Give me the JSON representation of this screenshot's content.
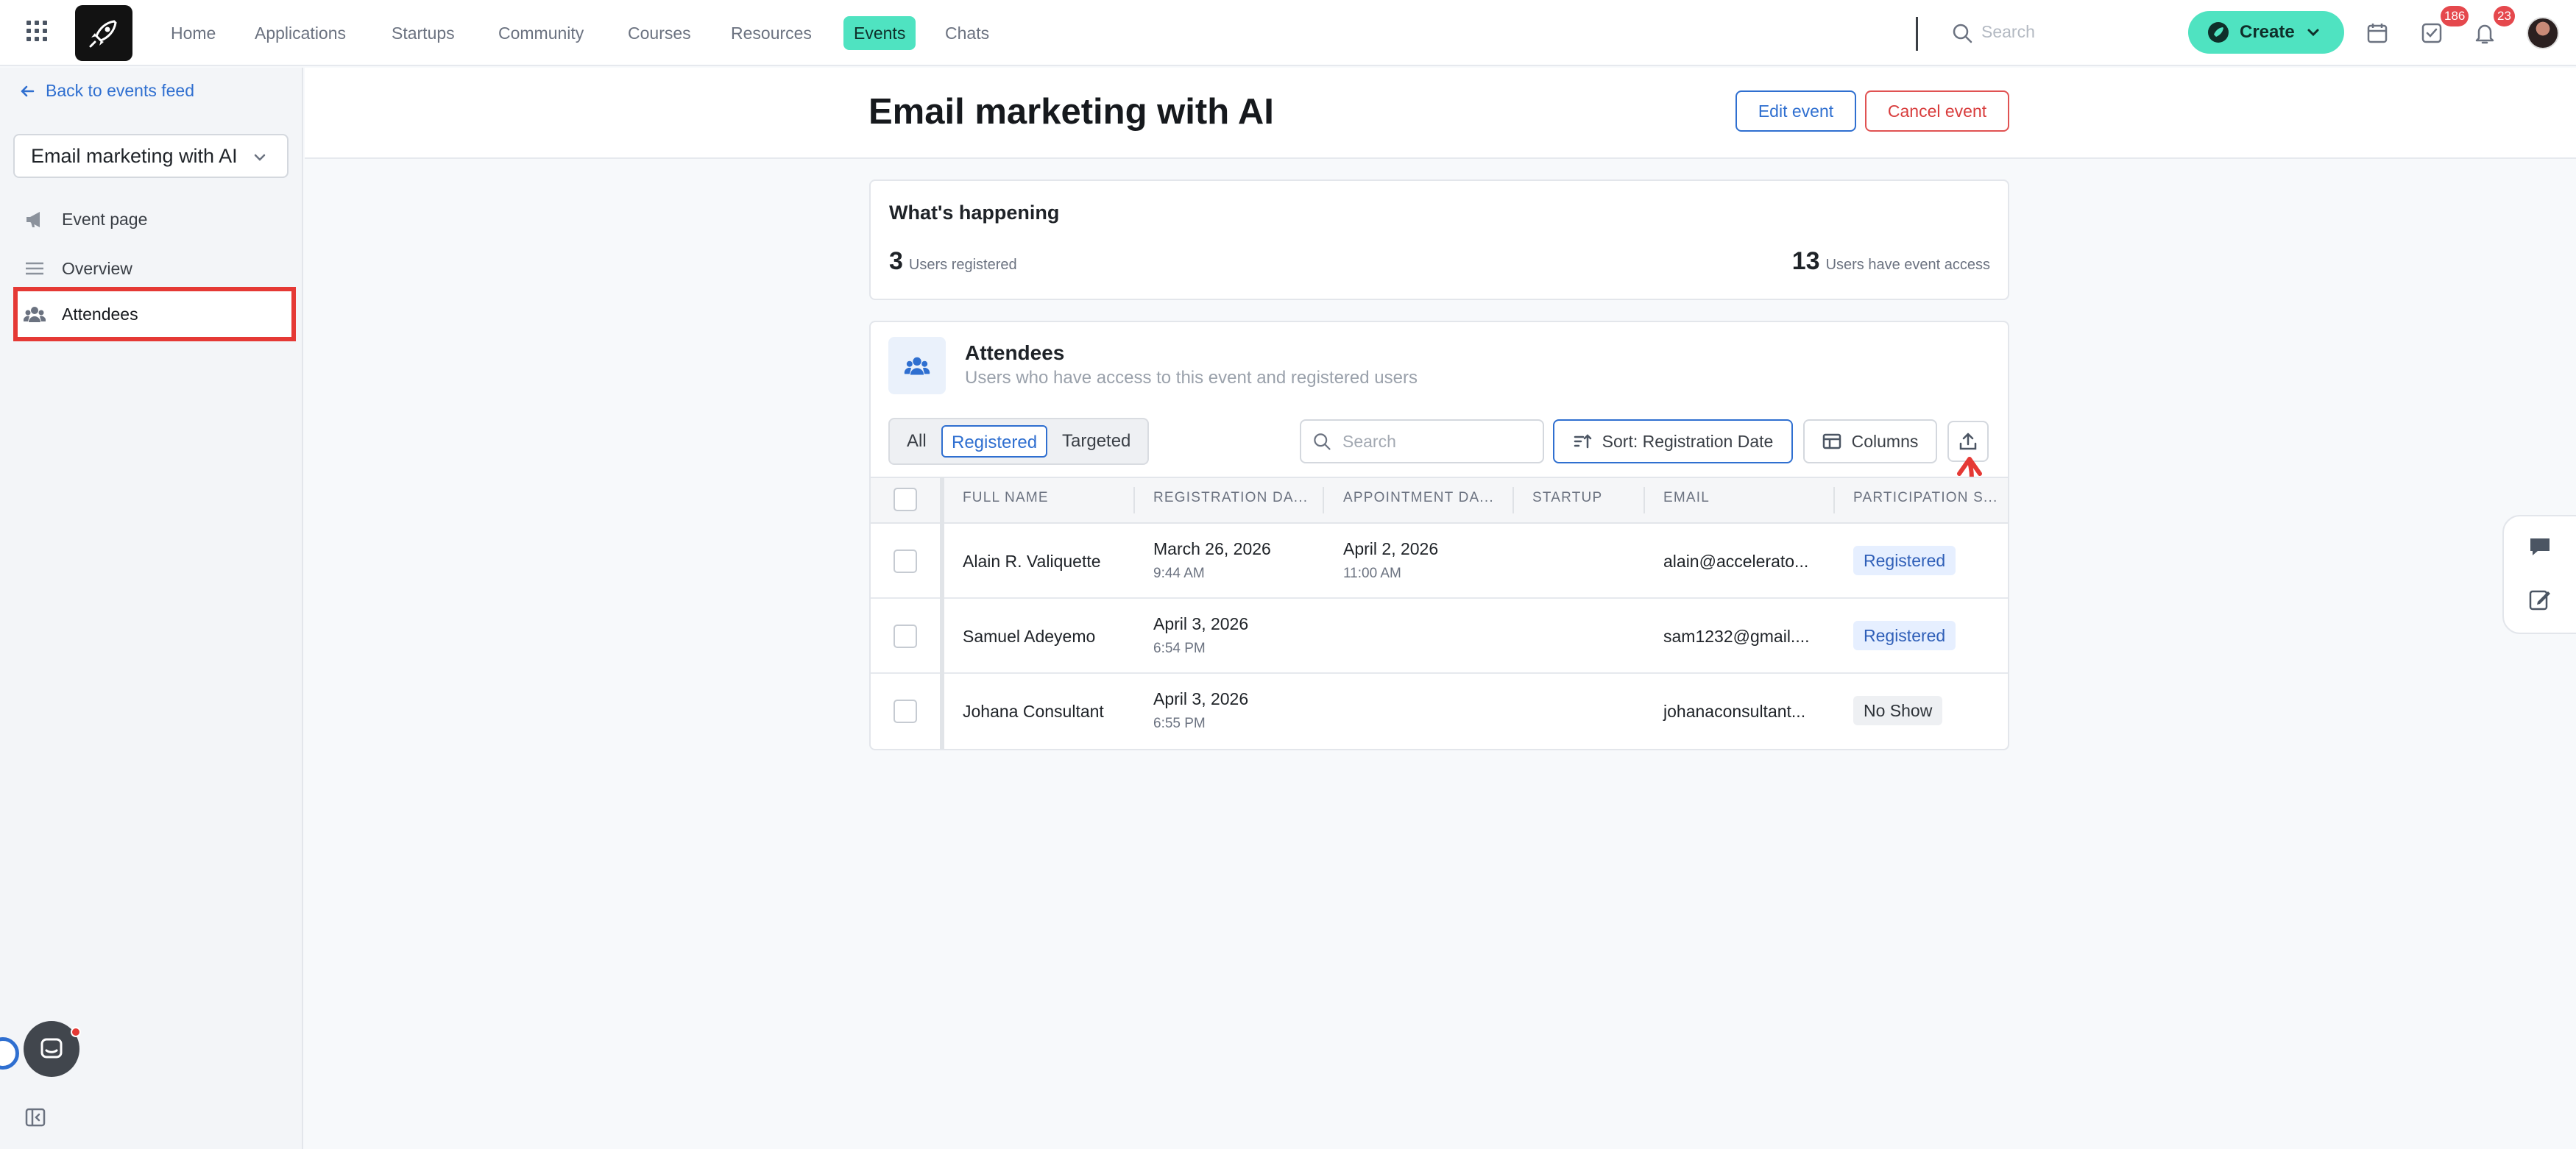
{
  "topnav": {
    "links": [
      "Home",
      "Applications",
      "Startups",
      "Community",
      "Courses",
      "Resources",
      "Events",
      "Chats"
    ],
    "active": "Events",
    "search_placeholder": "Search",
    "create_label": "Create",
    "tasks_badge": "186",
    "notifications_badge": "23"
  },
  "sidebar": {
    "back_label": "Back to events feed",
    "event_select": "Email marketing with AI",
    "items": [
      {
        "label": "Event page",
        "icon": "megaphone-icon"
      },
      {
        "label": "Overview",
        "icon": "list-icon"
      },
      {
        "label": "Attendees",
        "icon": "users-icon"
      }
    ]
  },
  "header": {
    "title": "Email marketing with AI",
    "edit_label": "Edit event",
    "cancel_label": "Cancel event"
  },
  "happening": {
    "title": "What's happening",
    "registered_count": "3",
    "registered_label": "Users registered",
    "access_count": "13",
    "access_label": "Users have event access"
  },
  "attendees": {
    "title": "Attendees",
    "subtitle": "Users who have access to this event and registered users",
    "filters": [
      "All",
      "Registered",
      "Targeted"
    ],
    "active_filter": "Registered",
    "search_placeholder": "Search",
    "sort_label": "Sort: Registration Date",
    "columns_label": "Columns",
    "columns": [
      "FULL NAME",
      "REGISTRATION DA...",
      "APPOINTMENT DA...",
      "STARTUP",
      "EMAIL",
      "PARTICIPATION S..."
    ],
    "rows": [
      {
        "name": "Alain R. Valiquette",
        "reg_date": "March 26, 2026",
        "reg_time": "9:44 AM",
        "appt_date": "April 2, 2026",
        "appt_time": "11:00 AM",
        "startup": "",
        "email": "alain@accelerato...",
        "status": "Registered"
      },
      {
        "name": "Samuel Adeyemo",
        "reg_date": "April 3, 2026",
        "reg_time": "6:54 PM",
        "appt_date": "",
        "appt_time": "",
        "startup": "",
        "email": "sam1232@gmail....",
        "status": "Registered"
      },
      {
        "name": "Johana Consultant",
        "reg_date": "April 3, 2026",
        "reg_time": "6:55 PM",
        "appt_date": "",
        "appt_time": "",
        "startup": "",
        "email": "johanaconsultant...",
        "status": "No Show"
      }
    ]
  },
  "colors": {
    "accent": "#4fe3c1",
    "link": "#2f6fd0",
    "danger": "#e53935"
  }
}
